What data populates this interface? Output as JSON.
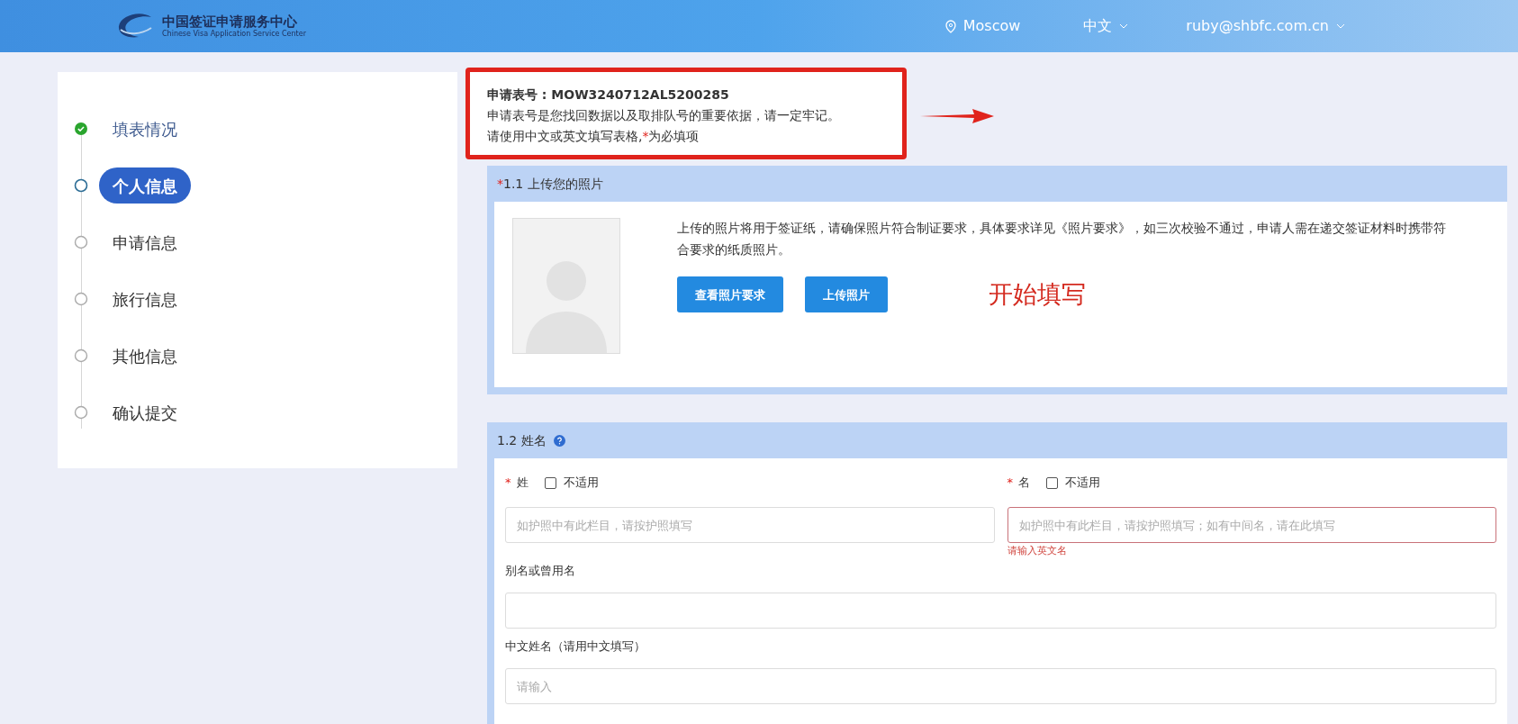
{
  "header": {
    "logo_title": "中国签证申请服务中心",
    "logo_subtitle": "Chinese Visa Application Service Center",
    "location": "Moscow",
    "language": "中文",
    "user": "ruby@shbfc.com.cn"
  },
  "steps": [
    {
      "label": "填表情况",
      "kind": "done",
      "selected": false
    },
    {
      "label": "个人信息",
      "kind": "current",
      "selected": true
    },
    {
      "label": "申请信息",
      "kind": "todo",
      "selected": false
    },
    {
      "label": "旅行信息",
      "kind": "todo",
      "selected": false
    },
    {
      "label": "其他信息",
      "kind": "todo",
      "selected": false
    },
    {
      "label": "确认提交",
      "kind": "todo",
      "selected": false
    }
  ],
  "notice": {
    "number_label": "申请表号 : MOW3240712AL5200285",
    "remember": "申请表号是您找回数据以及取排队号的重要依据，请一定牢记。",
    "instruction_before": "请使用中文或英文填写表格,",
    "required_mark": "*",
    "instruction_after": "为必填项"
  },
  "annotation": {
    "text": "开始填写"
  },
  "photo_section": {
    "required": true,
    "title": "1.1 上传您的照片",
    "description": "上传的照片将用于签证纸，请确保照片符合制证要求，具体要求详见《照片要求》，如三次校验不通过，申请人需在递交签证材料时携带符合要求的纸质照片。",
    "buttons": [
      "查看照片要求",
      "上传照片"
    ]
  },
  "name_section": {
    "title": "1.2 姓名",
    "surname": {
      "label": "姓",
      "required": true,
      "na_label": "不适用",
      "checked": false,
      "placeholder": "如护照中有此栏目，请按护照填写",
      "error": false
    },
    "given_name": {
      "label": "名",
      "required": true,
      "na_label": "不适用",
      "checked": false,
      "placeholder": "如护照中有此栏目，请按护照填写；如有中间名，请在此填写",
      "error": true,
      "error_text": "请输入英文名"
    },
    "alias": {
      "label": "别名或曾用名"
    },
    "chinese_name": {
      "label": "中文姓名（请用中文填写）",
      "placeholder": "请输入"
    }
  }
}
